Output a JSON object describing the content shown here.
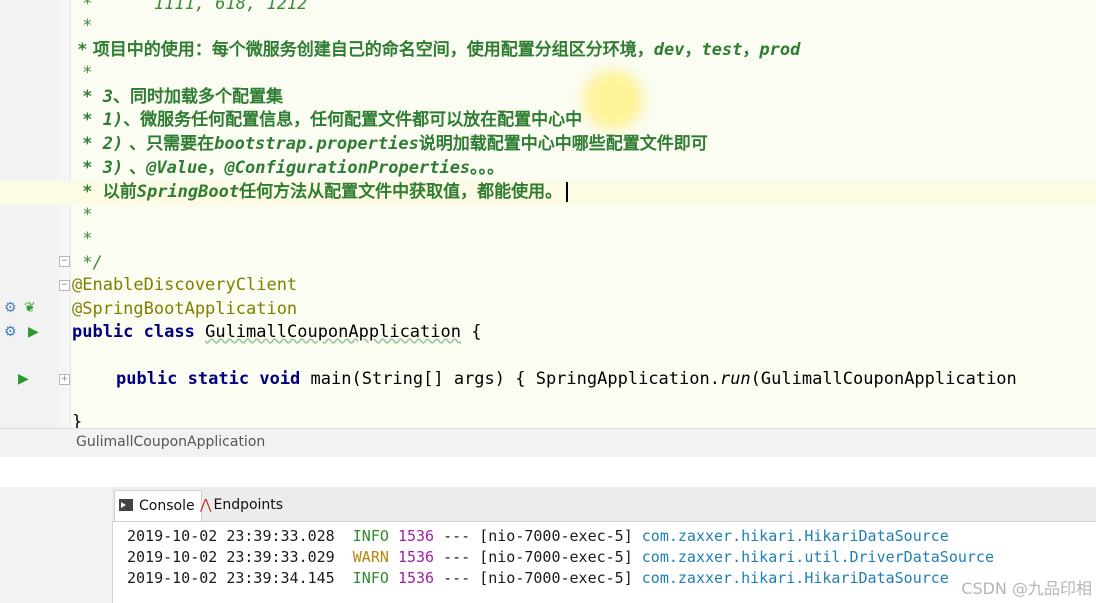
{
  "editor": {
    "doc_lines": [
      {
        "text": " *      1111, 618, 1212"
      },
      {
        "text": " *"
      },
      {
        "zh": " * 项目中的使用：每个微服务创建自己的命名空间，使用配置分组区分环境，",
        "code": "dev",
        "sep1": "，",
        "code2": "test",
        "sep2": "，",
        "code3": "prod"
      },
      {
        "text": " *"
      },
      {
        "code": " * 3",
        "zh": "、同时加载多个配置集"
      },
      {
        "code": " * 1)",
        "zh": "、微服务任何配置信息，任何配置文件都可以放在配置中心中"
      },
      {
        "code": " * 2)",
        "zh": " 、只需要在",
        "code2": "bootstrap.properties",
        "zh2": "说明加载配置中心中哪些配置文件即可"
      },
      {
        "code": " * 3)",
        "zh": " 、",
        "code2": "@Value",
        "zh2": "，",
        "code3": "@ConfigurationProperties",
        "zh3": "。。。"
      },
      {
        "code": " * ",
        "zh": "以前",
        "code2": "SpringBoot",
        "zh2": "任何方法从配置文件中获取值，都能使用。"
      },
      {
        "text": " *"
      },
      {
        "text": " *"
      },
      {
        "text": " */"
      }
    ],
    "annotations": [
      "@EnableDiscoveryClient",
      "@SpringBootApplication"
    ],
    "class_decl": {
      "kw1": "public",
      "kw2": "class",
      "name": "GulimallCouponApplication",
      "brace": " {"
    },
    "main_decl": {
      "kw1": "public",
      "kw2": "static",
      "kw3": "void",
      "sig": "main(String[] args) { SpringApplication.",
      "call": "run",
      "rest": "(GulimallCouponApplication"
    },
    "closing": "}"
  },
  "breadcrumb": "GulimallCouponApplication",
  "tabs": [
    {
      "label": "Console",
      "icon": "console-icon",
      "active": true
    },
    {
      "label": "Endpoints",
      "icon": "endpoints-icon",
      "active": false
    }
  ],
  "log": [
    {
      "ts": "2019-10-02 23:39:33.028",
      "level": "INFO",
      "pid": "1536",
      "sep": "---",
      "thread": "[nio-7000-exec-5]",
      "logger": "com.zaxxer.hikari.HikariDataSource"
    },
    {
      "ts": "2019-10-02 23:39:33.029",
      "level": "WARN",
      "pid": "1536",
      "sep": "---",
      "thread": "[nio-7000-exec-5]",
      "logger": "com.zaxxer.hikari.util.DriverDataSource"
    },
    {
      "ts": "2019-10-02 23:39:34.145",
      "level": "INFO",
      "pid": "1536",
      "sep": "---",
      "thread": "[nio-7000-exec-5]",
      "logger": "com.zaxxer.hikari.HikariDataSource"
    }
  ],
  "watermark": "CSDN @九品印相",
  "colors": {
    "annotation": "#808000",
    "keyword": "#000080",
    "doc_comment": "#3a8a3a",
    "info": "#2e8b2e",
    "warn": "#b8860b",
    "logger": "#1e7fb5"
  }
}
